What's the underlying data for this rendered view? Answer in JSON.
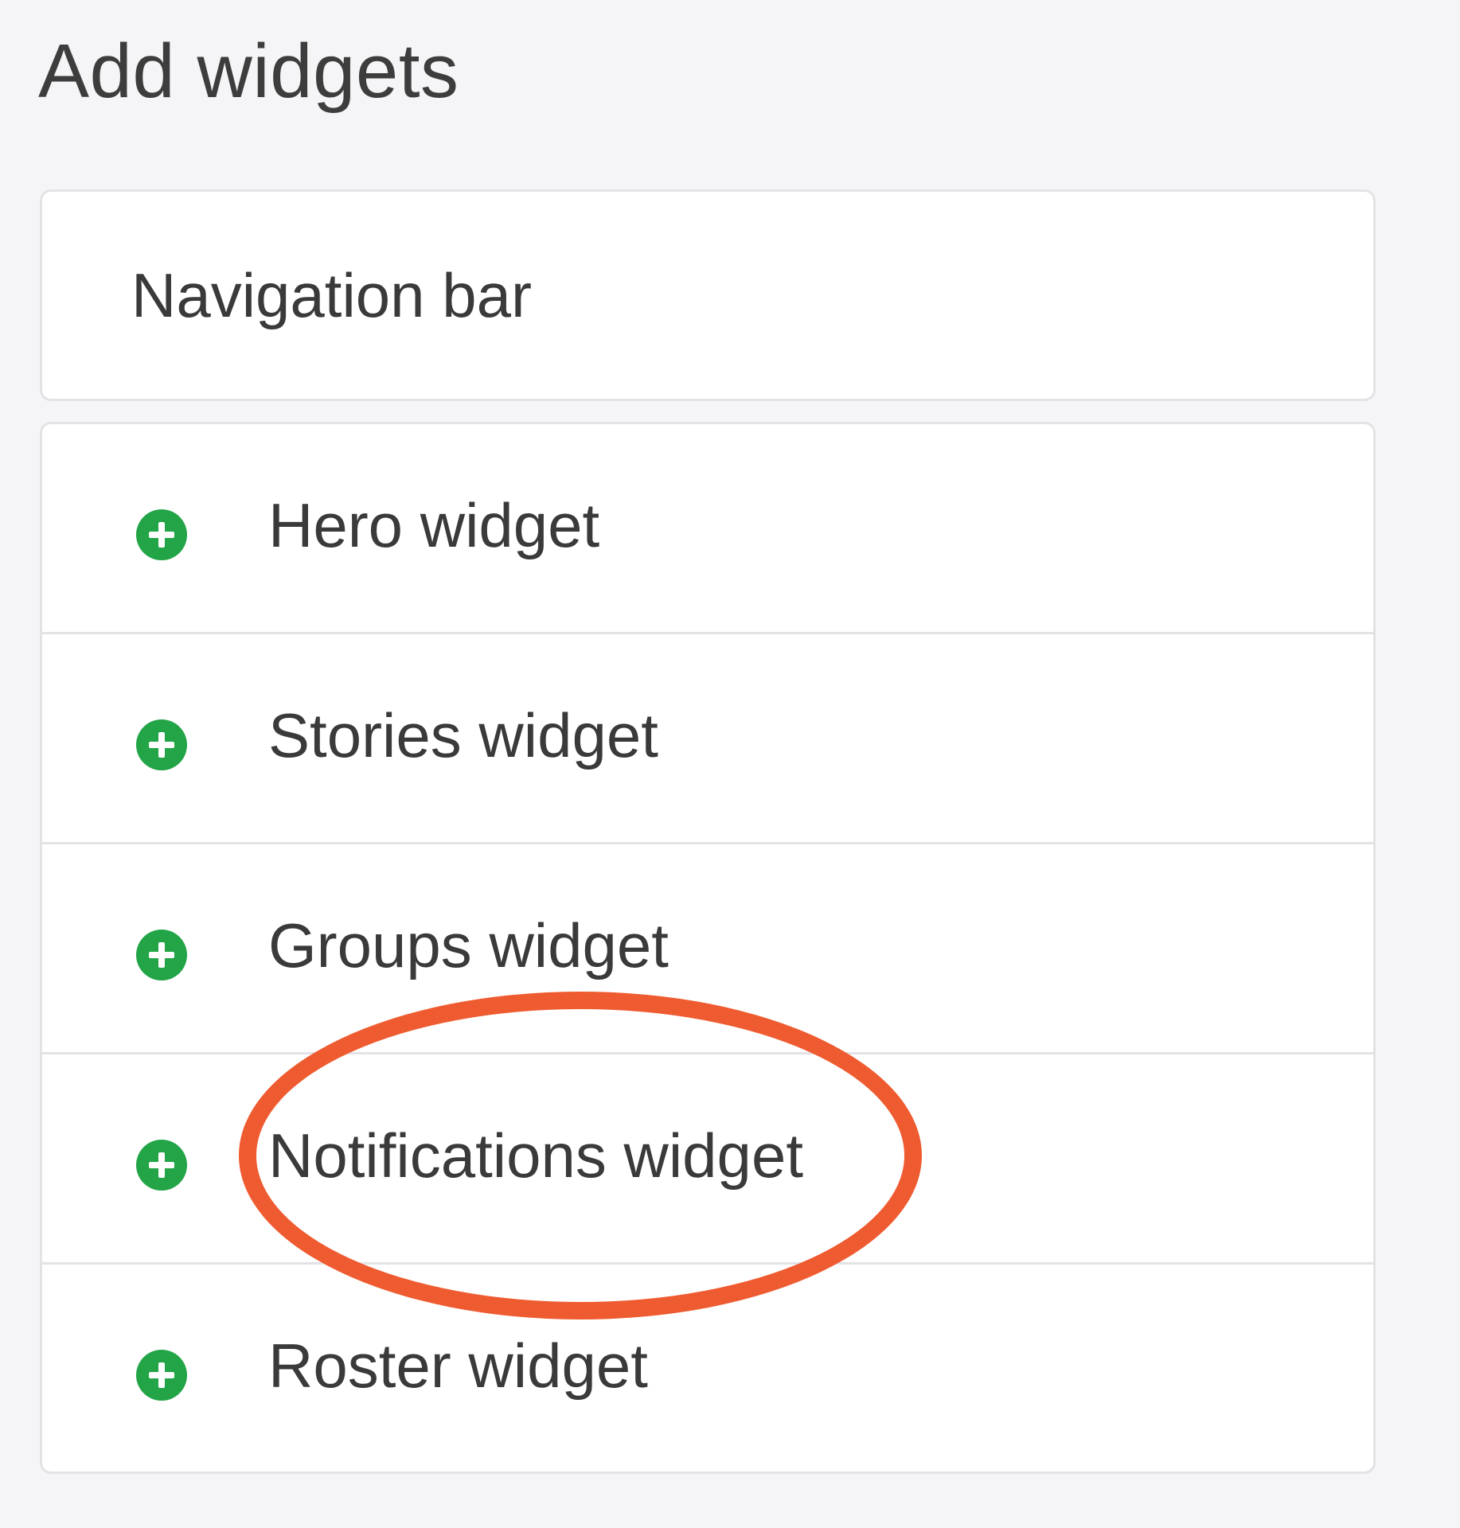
{
  "page": {
    "title": "Add widgets"
  },
  "navigation_section": {
    "label": "Navigation bar"
  },
  "widgets": [
    {
      "label": "Hero widget",
      "icon": "add-circle-icon"
    },
    {
      "label": "Stories widget",
      "icon": "add-circle-icon"
    },
    {
      "label": "Groups widget",
      "icon": "add-circle-icon"
    },
    {
      "label": "Notifications widget",
      "icon": "add-circle-icon"
    },
    {
      "label": "Roster widget",
      "icon": "add-circle-icon"
    }
  ],
  "colors": {
    "background": "#f5f5f7",
    "card": "#ffffff",
    "border": "#e3e3e6",
    "add_icon": "#22a447",
    "annotation": "#ef5b30"
  }
}
